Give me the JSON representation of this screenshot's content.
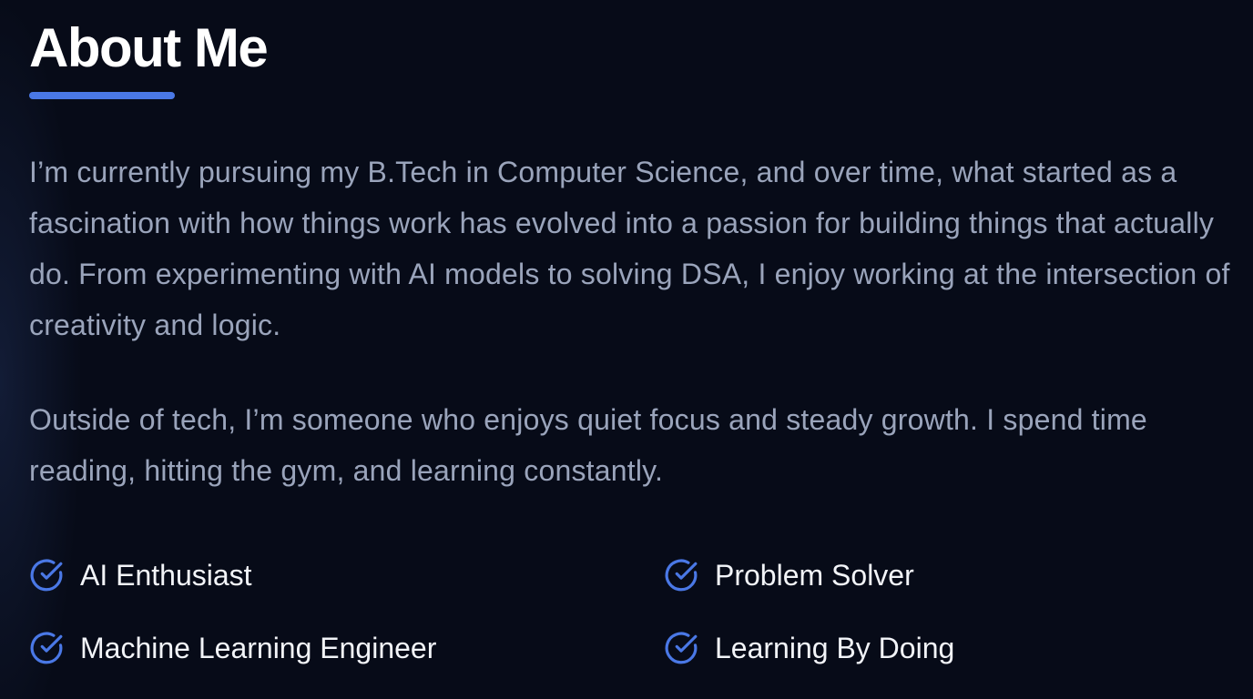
{
  "section": {
    "title": "About Me",
    "paragraphs": [
      "I’m currently pursuing my B.Tech in Computer Science, and over time, what started as a fascination with how things work has evolved into a passion for building things that actually do. From experimenting with AI models to solving DSA, I enjoy working at the intersection of creativity and logic.",
      "Outside of tech, I’m someone who enjoys quiet focus and steady growth. I spend time reading, hitting the gym, and learning constantly."
    ],
    "highlights": [
      {
        "label": "AI Enthusiast",
        "icon": "check-circle-icon"
      },
      {
        "label": "Problem Solver",
        "icon": "check-circle-icon"
      },
      {
        "label": "Machine Learning Engineer",
        "icon": "check-circle-icon"
      },
      {
        "label": "Learning By Doing",
        "icon": "check-circle-icon"
      }
    ]
  },
  "colors": {
    "background": "#070b18",
    "accent": "#4a78e6",
    "heading": "#ffffff",
    "body_text": "#9aa4bb",
    "highlight_text": "#f2f4f8"
  }
}
